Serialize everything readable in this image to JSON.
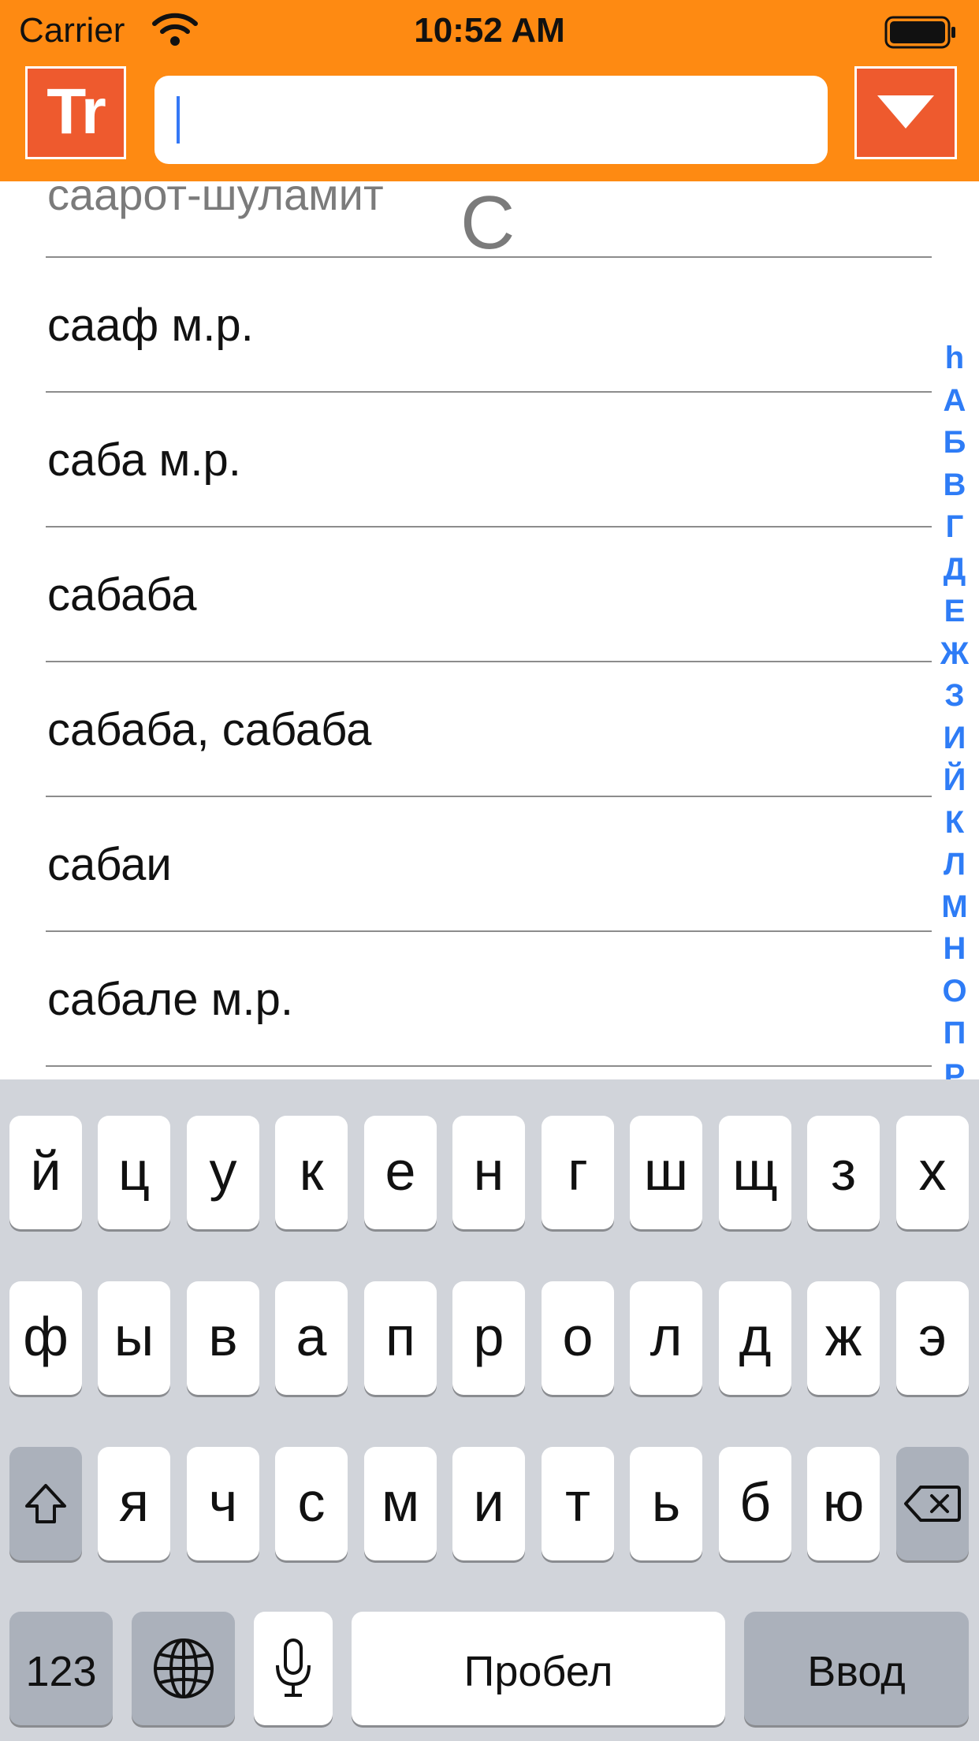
{
  "status_bar": {
    "carrier": "Carrier",
    "time": "10:52 AM"
  },
  "header": {
    "tr_label": "Tr",
    "search": {
      "value": "",
      "placeholder": ""
    }
  },
  "list": {
    "top_entry": "саарот-шуламит",
    "section_letter": "С",
    "rows": [
      "сааф м.р.",
      "саба м.р.",
      "сабаба",
      "сабаба, сабаба",
      "сабаи",
      "сабале м.р."
    ]
  },
  "index": [
    "һ",
    "А",
    "Б",
    "В",
    "Г",
    "Д",
    "Е",
    "Ж",
    "З",
    "И",
    "Й",
    "К",
    "Л",
    "М",
    "Н",
    "О",
    "П",
    "Р"
  ],
  "keyboard": {
    "row1": [
      "й",
      "ц",
      "у",
      "к",
      "е",
      "н",
      "г",
      "ш",
      "щ",
      "з",
      "х"
    ],
    "row2": [
      "ф",
      "ы",
      "в",
      "а",
      "п",
      "р",
      "о",
      "л",
      "д",
      "ж",
      "э"
    ],
    "row3": [
      "я",
      "ч",
      "с",
      "м",
      "и",
      "т",
      "ь",
      "б",
      "ю"
    ],
    "numbers_label": "123",
    "space_label": "Пробел",
    "enter_label": "Ввод"
  },
  "colors": {
    "header_bg": "#fe8a12",
    "button_bg": "#ee5a2e",
    "index_text": "#2e7cf6"
  }
}
